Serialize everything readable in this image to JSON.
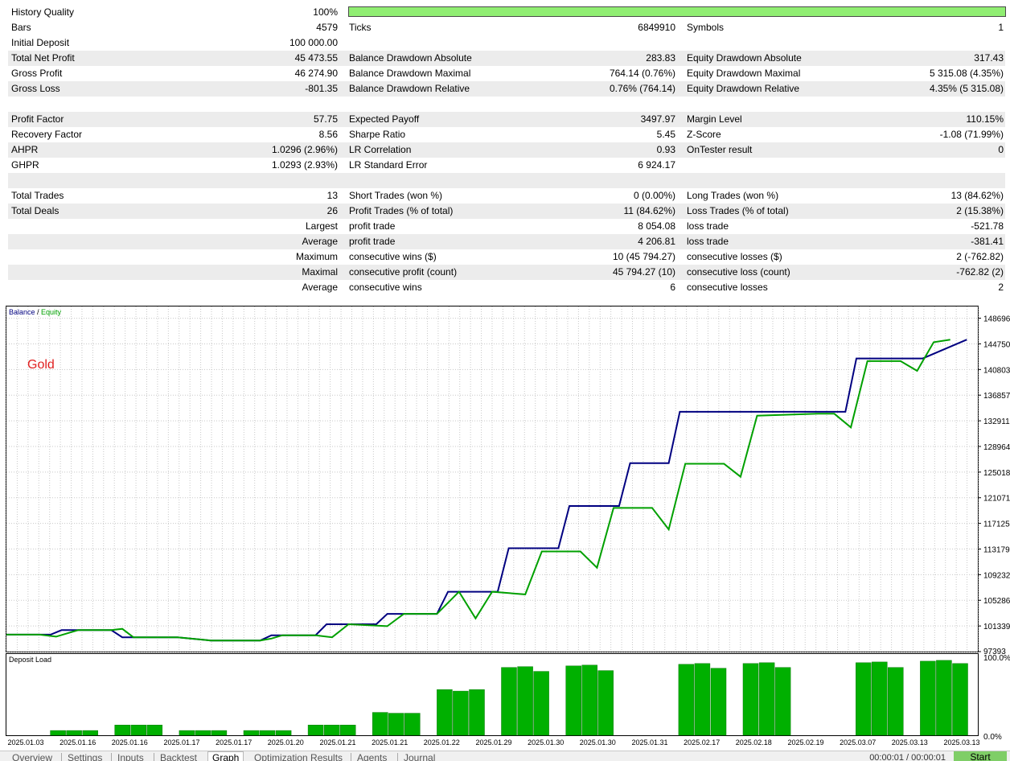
{
  "colors": {
    "balance": "#000080",
    "equity": "#00a000",
    "bar": "#00b000",
    "grid": "#c8c8c8",
    "gold_label": "#e02020",
    "quality_fill": "#90ee72",
    "row_shade": "#ececec"
  },
  "stats": {
    "history_quality": {
      "label": "History Quality",
      "value": "100%",
      "fill_fraction": 1.0
    },
    "rows": [
      {
        "shade": false,
        "cells": [
          "Bars",
          "4579",
          "Ticks",
          "6849910",
          "Symbols",
          "1"
        ]
      },
      {
        "shade": false,
        "cells": [
          "Initial Deposit",
          "100 000.00",
          "",
          "",
          "",
          ""
        ]
      },
      {
        "shade": true,
        "cells": [
          "Total Net Profit",
          "45 473.55",
          "Balance Drawdown Absolute",
          "283.83",
          "Equity Drawdown Absolute",
          "317.43"
        ]
      },
      {
        "shade": false,
        "cells": [
          "Gross Profit",
          "46 274.90",
          "Balance Drawdown Maximal",
          "764.14 (0.76%)",
          "Equity Drawdown Maximal",
          "5 315.08 (4.35%)"
        ]
      },
      {
        "shade": true,
        "cells": [
          "Gross Loss",
          "-801.35",
          "Balance Drawdown Relative",
          "0.76% (764.14)",
          "Equity Drawdown Relative",
          "4.35% (5 315.08)"
        ]
      },
      {
        "shade": false,
        "cells": [
          "",
          "",
          "",
          "",
          "",
          ""
        ]
      },
      {
        "shade": true,
        "cells": [
          "Profit Factor",
          "57.75",
          "Expected Payoff",
          "3497.97",
          "Margin Level",
          "110.15%"
        ]
      },
      {
        "shade": false,
        "cells": [
          "Recovery Factor",
          "8.56",
          "Sharpe Ratio",
          "5.45",
          "Z-Score",
          "-1.08 (71.99%)"
        ]
      },
      {
        "shade": true,
        "cells": [
          "AHPR",
          "1.0296 (2.96%)",
          "LR Correlation",
          "0.93",
          "OnTester result",
          "0"
        ]
      },
      {
        "shade": false,
        "cells": [
          "GHPR",
          "1.0293 (2.93%)",
          "LR Standard Error",
          "6 924.17",
          "",
          ""
        ]
      },
      {
        "shade": true,
        "cells": [
          "",
          "",
          "",
          "",
          "",
          ""
        ]
      },
      {
        "shade": false,
        "cells": [
          "Total Trades",
          "13",
          "Short Trades (won %)",
          "0 (0.00%)",
          "Long Trades (won %)",
          "13 (84.62%)"
        ]
      },
      {
        "shade": true,
        "cells": [
          "Total Deals",
          "26",
          "Profit Trades (% of total)",
          "11 (84.62%)",
          "Loss Trades (% of total)",
          "2 (15.38%)"
        ]
      },
      {
        "shade": false,
        "cells": [
          "",
          "Largest",
          "profit trade",
          "8 054.08",
          "loss trade",
          "-521.78"
        ]
      },
      {
        "shade": true,
        "cells": [
          "",
          "Average",
          "profit trade",
          "4 206.81",
          "loss trade",
          "-381.41"
        ]
      },
      {
        "shade": false,
        "cells": [
          "",
          "Maximum",
          "consecutive wins ($)",
          "10 (45 794.27)",
          "consecutive losses ($)",
          "2 (-762.82)"
        ]
      },
      {
        "shade": true,
        "cells": [
          "",
          "Maximal",
          "consecutive profit (count)",
          "45 794.27 (10)",
          "consecutive loss (count)",
          "-762.82 (2)"
        ]
      },
      {
        "shade": false,
        "cells": [
          "",
          "Average",
          "consecutive wins",
          "6",
          "consecutive losses",
          "2"
        ]
      }
    ]
  },
  "chart_data": [
    {
      "type": "line",
      "legend": [
        "Balance",
        "Equity"
      ],
      "legend_sep": " / ",
      "annotation": "Gold",
      "y_ticks": [
        "148696",
        "144750",
        "140803",
        "136857",
        "132911",
        "128964",
        "125018",
        "121071",
        "117125",
        "113179",
        "109232",
        "105286",
        "101339",
        "97393"
      ],
      "ylim": [
        97393,
        150500
      ],
      "grid": true,
      "x_count": 90,
      "series": [
        {
          "name": "Balance",
          "points": [
            [
              0,
              100000
            ],
            [
              8,
              100000
            ],
            [
              10,
              100700
            ],
            [
              19,
              100700
            ],
            [
              21,
              99600
            ],
            [
              31,
              99600
            ],
            [
              37,
              99100
            ],
            [
              46,
              99100
            ],
            [
              48,
              99900
            ],
            [
              56,
              99900
            ],
            [
              58,
              101600
            ],
            [
              67,
              101600
            ],
            [
              69,
              103200
            ],
            [
              78,
              103200
            ],
            [
              80,
              106600
            ],
            [
              89,
              106600
            ],
            [
              91,
              113300
            ],
            [
              100,
              113300
            ],
            [
              102,
              119800
            ],
            [
              111,
              119800
            ],
            [
              113,
              126400
            ],
            [
              120,
              126400
            ],
            [
              122,
              134300
            ],
            [
              131,
              134300
            ],
            [
              133,
              134300
            ],
            [
              152,
              134300
            ],
            [
              154,
              142500
            ],
            [
              164,
              142500
            ],
            [
              166,
              142500
            ],
            [
              174,
              145400
            ]
          ]
        },
        {
          "name": "Equity",
          "points": [
            [
              0,
              100000
            ],
            [
              6,
              100000
            ],
            [
              9,
              99700
            ],
            [
              13,
              100700
            ],
            [
              19,
              100700
            ],
            [
              21,
              100900
            ],
            [
              23,
              99600
            ],
            [
              31,
              99600
            ],
            [
              37,
              99100
            ],
            [
              46,
              99100
            ],
            [
              48,
              99400
            ],
            [
              50,
              99900
            ],
            [
              56,
              99900
            ],
            [
              59,
              99600
            ],
            [
              62,
              101600
            ],
            [
              69,
              101300
            ],
            [
              72,
              103200
            ],
            [
              78,
              103200
            ],
            [
              82,
              106600
            ],
            [
              85,
              102500
            ],
            [
              88,
              106600
            ],
            [
              94,
              106200
            ],
            [
              97,
              112800
            ],
            [
              104,
              112800
            ],
            [
              107,
              110300
            ],
            [
              110,
              119500
            ],
            [
              117,
              119500
            ],
            [
              120,
              116200
            ],
            [
              123,
              126300
            ],
            [
              130,
              126300
            ],
            [
              133,
              124300
            ],
            [
              136,
              133700
            ],
            [
              147,
              134000
            ],
            [
              150,
              134000
            ],
            [
              153,
              131900
            ],
            [
              156,
              142100
            ],
            [
              162,
              142100
            ],
            [
              165,
              140600
            ],
            [
              168,
              145000
            ],
            [
              171,
              145400
            ]
          ]
        }
      ]
    },
    {
      "type": "bar",
      "title": "Deposit Load",
      "y_ticks": [
        "100.0%",
        "0.0%"
      ],
      "ylim": [
        0,
        100
      ],
      "x_labels": [
        "2025.01.03",
        "2025.01.16",
        "2025.01.16",
        "2025.01.17",
        "2025.01.17",
        "2025.01.20",
        "2025.01.21",
        "2025.01.21",
        "2025.01.22",
        "2025.01.29",
        "2025.01.30",
        "2025.01.30",
        "2025.01.31",
        "2025.02.17",
        "2025.02.18",
        "2025.02.19",
        "2025.03.07",
        "2025.03.13",
        "2025.03.13"
      ],
      "values": [
        0,
        0,
        6,
        6,
        6,
        0,
        13,
        13,
        13,
        0,
        6,
        6,
        6,
        0,
        6,
        6,
        6,
        0,
        13,
        13,
        13,
        0,
        29,
        28,
        28,
        0,
        58,
        56,
        58,
        0,
        86,
        87,
        81,
        0,
        88,
        89,
        82,
        0,
        0,
        0,
        0,
        90,
        91,
        85,
        0,
        91,
        92,
        86,
        0,
        0,
        0,
        0,
        92,
        93,
        86,
        0,
        94,
        95,
        91
      ]
    }
  ],
  "tabs": [
    {
      "label": "Overview",
      "active": false
    },
    {
      "label": "Settings",
      "active": false
    },
    {
      "label": "Inputs",
      "active": false
    },
    {
      "label": "Backtest",
      "active": false
    },
    {
      "label": "Graph",
      "active": true
    },
    {
      "label": "Optimization Results",
      "active": false
    },
    {
      "label": "Agents",
      "active": false
    },
    {
      "label": "Journal",
      "active": false
    }
  ],
  "timer": "00:00:01 / 00:00:01",
  "start_label": "Start"
}
